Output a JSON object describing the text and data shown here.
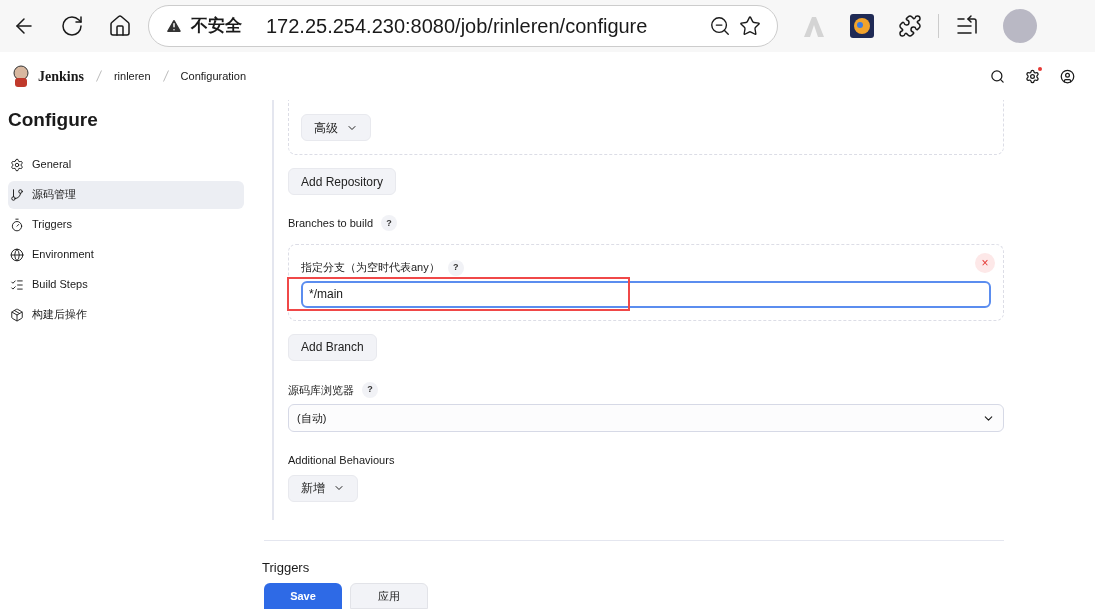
{
  "browser": {
    "security_label": "不安全",
    "url": "172.25.254.230:8080/job/rinleren/configure"
  },
  "header": {
    "brand": "Jenkins",
    "breadcrumbs": [
      "rinleren",
      "Configuration"
    ],
    "settings_alert": true
  },
  "sidebar": {
    "title": "Configure",
    "items": [
      {
        "label": "General",
        "kind": "gear",
        "selected": false
      },
      {
        "label": "源码管理",
        "kind": "branch",
        "selected": true
      },
      {
        "label": "Triggers",
        "kind": "timer",
        "selected": false
      },
      {
        "label": "Environment",
        "kind": "globe",
        "selected": false
      },
      {
        "label": "Build Steps",
        "kind": "list",
        "selected": false
      },
      {
        "label": "构建后操作",
        "kind": "box",
        "selected": false
      }
    ]
  },
  "content": {
    "advanced_button": "高级",
    "add_repository_button": "Add Repository",
    "branches_label": "Branches to build",
    "help": "?",
    "branch": {
      "label": "指定分支（为空时代表any）",
      "value": "*/main",
      "remove": "×"
    },
    "add_branch_button": "Add Branch",
    "browser_label": "源码库浏览器",
    "browser_select": "(自动)",
    "behaviours_label": "Additional Behaviours",
    "add_button": "新增",
    "next_section": "Triggers"
  },
  "footer": {
    "save": "Save",
    "apply": "应用"
  }
}
